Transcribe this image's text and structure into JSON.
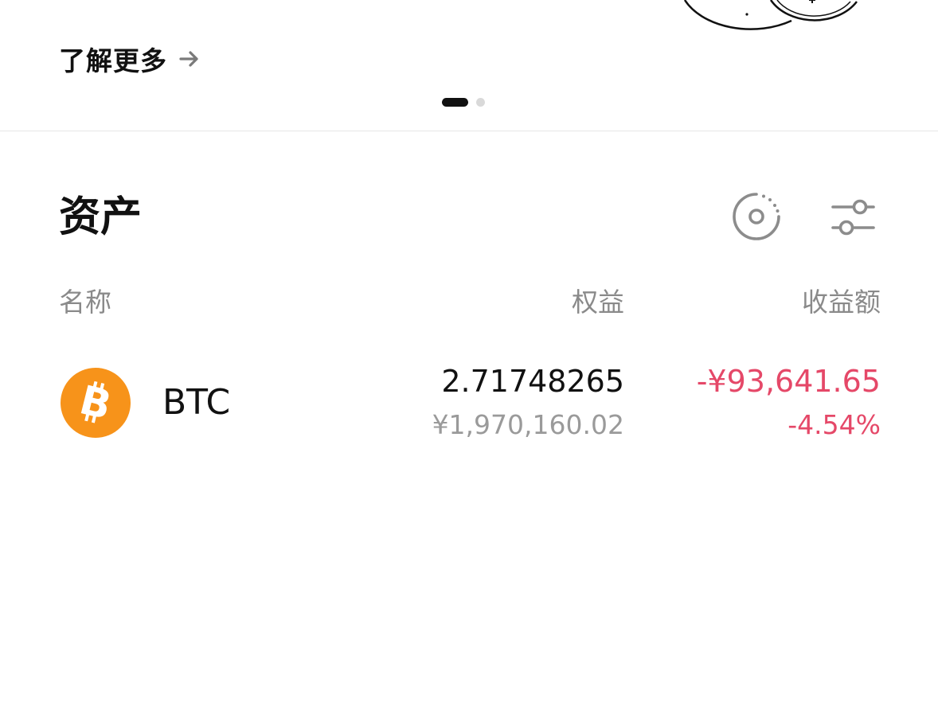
{
  "banner": {
    "learn_more_label": "了解更多",
    "arrow_icon": "arrow-right-icon",
    "illustration_icon": "coins-illustration-icon",
    "pager": {
      "total": 2,
      "active": 1
    }
  },
  "assets": {
    "title": "资产",
    "toolbar": {
      "chart_icon": "distribution-chart-icon",
      "filter_icon": "sliders-icon"
    },
    "columns": {
      "name": "名称",
      "equity": "权益",
      "pnl": "收益额"
    },
    "rows": [
      {
        "symbol": "BTC",
        "icon": "bitcoin-icon",
        "icon_color": "#F7931A",
        "equity_amount": "2.71748265",
        "equity_fiat": "¥1,970,160.02",
        "pnl_amount": "-¥93,641.65",
        "pnl_percent": "-4.54%"
      }
    ]
  },
  "colors": {
    "negative": "#E54868",
    "text_primary": "#111111",
    "text_secondary": "#8A8A8A"
  }
}
